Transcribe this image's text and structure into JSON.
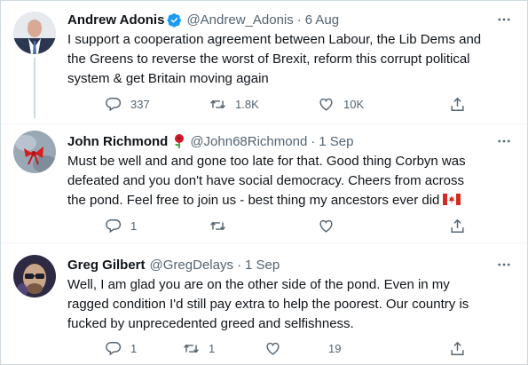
{
  "tweets": [
    {
      "name": "Andrew Adonis",
      "verified": true,
      "handle": "@Andrew_Adonis",
      "dot": "·",
      "date": "6 Aug",
      "lines": [
        "I support a cooperation agreement between Labour, the Lib Dems and",
        "the Greens to reverse the worst of Brexit, reform this corrupt political",
        "system & get Britain moving again"
      ],
      "replies": "337",
      "retweets": "1.8K",
      "likes": "10K"
    },
    {
      "name": "John Richmond",
      "name_emoji": "rose-icon",
      "handle": "@John68Richmond",
      "dot": "·",
      "date": "1 Sep",
      "lines": [
        "Must be well and and gone too late for that.  Good thing Corbyn was",
        "defeated and you don't have social democracy.  Cheers from across",
        "the pond.  Feel free to join us - best thing my ancestors ever did"
      ],
      "trailing_emoji": "canada-flag-icon",
      "replies": "1",
      "retweets": "",
      "likes": ""
    },
    {
      "name": "Greg Gilbert",
      "handle": "@GregDelays",
      "dot": "·",
      "date": "1 Sep",
      "lines": [
        "Well, I am glad you are on the other side of the pond. Even in my",
        "ragged condition I'd still pay extra to help the poorest. Our country is",
        "fucked by unprecedented greed and selfishness."
      ],
      "replies": "1",
      "retweets": "1",
      "likes": "19"
    }
  ],
  "colors": {
    "text": "#0f1419",
    "secondary": "#536471",
    "verified": "#1d9bf0",
    "border": "#cfd9de"
  }
}
